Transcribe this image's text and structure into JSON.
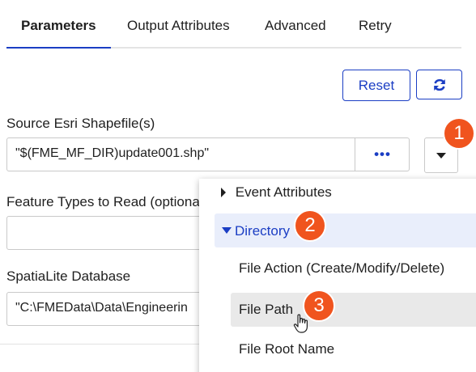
{
  "tabs": [
    {
      "label": "Parameters",
      "active": true
    },
    {
      "label": "Output Attributes",
      "active": false
    },
    {
      "label": "Advanced",
      "active": false
    },
    {
      "label": "Retry",
      "active": false
    }
  ],
  "toolbar": {
    "reset_label": "Reset",
    "refresh_icon": "refresh-icon"
  },
  "source": {
    "label": "Source Esri Shapefile(s)",
    "value": "\"$(FME_MF_DIR)update001.shp\"",
    "browse_label": "•••"
  },
  "feature_types": {
    "label": "Feature Types to Read (optiona",
    "value": ""
  },
  "spatialite": {
    "label": "SpatiaLite Database",
    "value": "\"C:\\FMEData\\Data\\Engineerin"
  },
  "menu": {
    "items": [
      {
        "label": "Event Attributes",
        "expanded": false
      },
      {
        "label": "Directory",
        "expanded": true
      },
      {
        "label": "File Action (Create/Modify/Delete)"
      },
      {
        "label": "File Path"
      },
      {
        "label": "File Root Name"
      }
    ]
  },
  "badges": [
    "1",
    "2",
    "3"
  ],
  "colors": {
    "accent": "#1b3ec4",
    "badge": "#f0541e",
    "selected_row": "#e9eefb",
    "hover_row": "#e9e9e9"
  }
}
